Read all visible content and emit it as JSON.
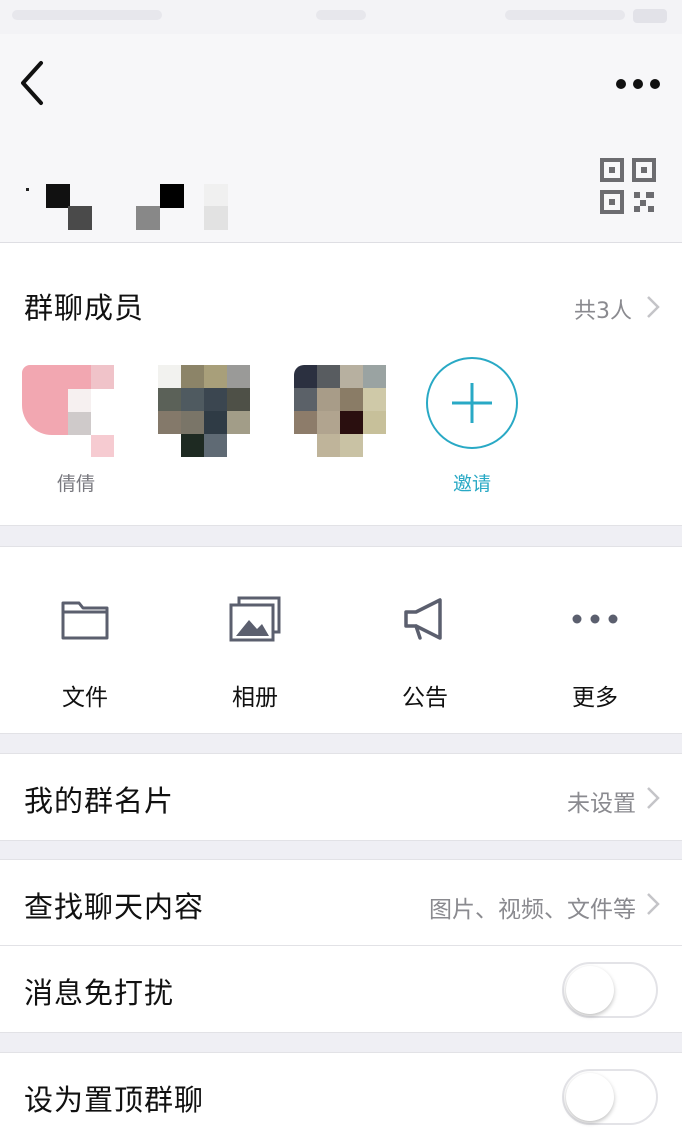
{
  "navbar": {
    "back_icon": "chevron-left-icon",
    "more_icon": "more-dots-icon"
  },
  "header": {
    "group_name": "",
    "qr_icon": "qr-code-icon"
  },
  "members": {
    "title": "群聊成员",
    "count": "共3人",
    "list": [
      {
        "name": "倩倩"
      },
      {
        "name": ""
      },
      {
        "name": ""
      }
    ],
    "invite_label": "邀请",
    "invite_icon": "plus-icon"
  },
  "tools": [
    {
      "label": "文件",
      "icon": "folder-icon"
    },
    {
      "label": "相册",
      "icon": "photo-album-icon"
    },
    {
      "label": "公告",
      "icon": "megaphone-icon"
    },
    {
      "label": "更多",
      "icon": "more-dots-icon"
    }
  ],
  "settings": {
    "card": {
      "label": "我的群名片",
      "value": "未设置"
    },
    "search": {
      "label": "查找聊天内容",
      "value": "图片、视频、文件等"
    },
    "mute": {
      "label": "消息免打扰",
      "on": false
    },
    "pin": {
      "label": "设为置顶群聊",
      "on": false
    }
  },
  "colors": {
    "accent": "#29a9c5",
    "background": "#efeff4",
    "secondary_text": "#8a8a8f"
  }
}
